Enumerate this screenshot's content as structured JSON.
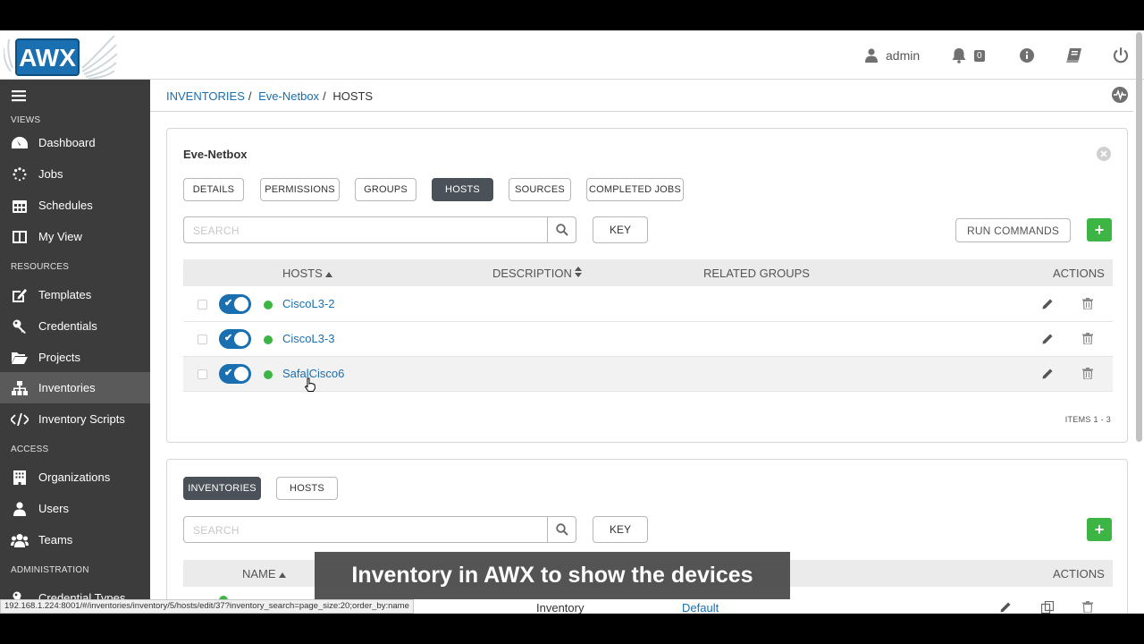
{
  "header": {
    "logo_text": "AWX",
    "user": "admin",
    "notifications_count": "0"
  },
  "sidebar": {
    "sections": {
      "views": "VIEWS",
      "resources": "RESOURCES",
      "access": "ACCESS",
      "administration": "ADMINISTRATION"
    },
    "items": [
      {
        "label": "Dashboard",
        "icon": "dashboard-icon"
      },
      {
        "label": "Jobs",
        "icon": "jobs-spinner-icon"
      },
      {
        "label": "Schedules",
        "icon": "calendar-icon"
      },
      {
        "label": "My View",
        "icon": "columns-icon"
      },
      {
        "label": "Templates",
        "icon": "pencil-square-icon"
      },
      {
        "label": "Credentials",
        "icon": "key-icon"
      },
      {
        "label": "Projects",
        "icon": "folder-icon"
      },
      {
        "label": "Inventories",
        "icon": "sitemap-icon"
      },
      {
        "label": "Inventory Scripts",
        "icon": "code-icon"
      },
      {
        "label": "Organizations",
        "icon": "building-icon"
      },
      {
        "label": "Users",
        "icon": "user-icon"
      },
      {
        "label": "Teams",
        "icon": "users-icon"
      },
      {
        "label": "Credential Types",
        "icon": "key-icon"
      }
    ]
  },
  "breadcrumb": {
    "items": [
      "INVENTORIES",
      "Eve-Netbox",
      "HOSTS"
    ]
  },
  "hosts_panel": {
    "title": "Eve-Netbox",
    "tabs": [
      "DETAILS",
      "PERMISSIONS",
      "GROUPS",
      "HOSTS",
      "SOURCES",
      "COMPLETED JOBS"
    ],
    "selected_tab": "HOSTS",
    "search_placeholder": "SEARCH",
    "key_label": "KEY",
    "run_commands_label": "RUN COMMANDS",
    "add_label": "+",
    "columns": {
      "hosts": "HOSTS",
      "description": "DESCRIPTION",
      "related_groups": "RELATED GROUPS",
      "actions": "ACTIONS"
    },
    "rows": [
      {
        "name": "CiscoL3-2",
        "enabled": true,
        "status": "ok"
      },
      {
        "name": "CiscoL3-3",
        "enabled": true,
        "status": "ok"
      },
      {
        "name": "SafalCisco6",
        "enabled": true,
        "status": "ok"
      }
    ],
    "items_count": "ITEMS  1 - 3"
  },
  "inventories_panel": {
    "tabs": [
      "INVENTORIES",
      "HOSTS"
    ],
    "selected_tab": "INVENTORIES",
    "search_placeholder": "SEARCH",
    "key_label": "KEY",
    "add_label": "+",
    "columns": {
      "name": "NAME",
      "actions": "ACTIONS"
    },
    "partial_row": {
      "type": "Inventory",
      "organization": "Default"
    }
  },
  "status_url": "192.168.1.224:8001/#/inventories/inventory/5/hosts/edit/37?inventory_search=page_size:20;order_by:name",
  "caption": "Inventory in AWX to show the devices",
  "colors": {
    "sidebar_bg": "#3c3c3c",
    "link": "#1a6fb0",
    "success": "#3cb544",
    "selected_tab": "#4a5159"
  }
}
